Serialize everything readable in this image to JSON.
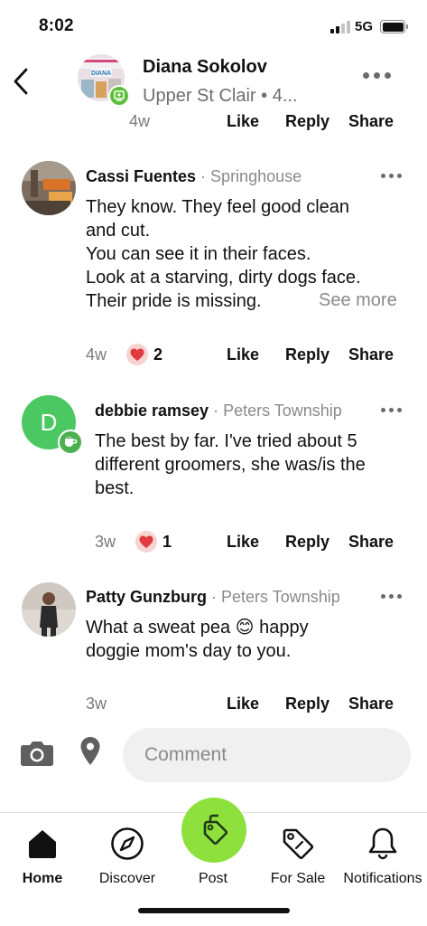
{
  "status_bar": {
    "time": "8:02",
    "network": "5G"
  },
  "header": {
    "author": "Diana Sokolov",
    "subtitle": "Upper St Clair • 4...",
    "avatar_text": "DIANA"
  },
  "main_post": {
    "ago": "4w",
    "like": "Like",
    "reply": "Reply",
    "share": "Share"
  },
  "comments": [
    {
      "author": "Cassi Fuentes",
      "separator": " · ",
      "location": "Springhouse",
      "lines": [
        "They know. They feel good clean",
        "and cut.",
        "You can see it in their faces.",
        "Look at a starving, dirty dogs face.",
        "Their pride is missing."
      ],
      "see_more": "See more",
      "ago": "4w",
      "reactions": "2",
      "like": "Like",
      "reply": "Reply",
      "share": "Share"
    },
    {
      "author": "debbie ramsey",
      "separator": " · ",
      "location": "Peters Township",
      "avatar_letter": "D",
      "lines": [
        "The best by far.  I've tried about 5",
        "different groomers, she was/is the",
        "best."
      ],
      "ago": "3w",
      "reactions": "1",
      "like": "Like",
      "reply": "Reply",
      "share": "Share"
    },
    {
      "author": "Patty Gunzburg",
      "separator": " · ",
      "location": "Peters Township",
      "line1_before": "What a sweat pea ",
      "line1_emoji": "😊",
      "line1_after": " happy",
      "line2": "doggie mom's day to you.",
      "ago": "3w",
      "like": "Like",
      "reply": "Reply",
      "share": "Share"
    }
  ],
  "composer": {
    "placeholder": "Comment"
  },
  "nav": {
    "items": [
      {
        "label": "Home",
        "active": true
      },
      {
        "label": "Discover",
        "active": false
      },
      {
        "label": "Post",
        "active": false
      },
      {
        "label": "For Sale",
        "active": false
      },
      {
        "label": "Notifications",
        "active": false
      }
    ]
  },
  "colors": {
    "accent_green": "#8ee03c",
    "badge_green": "#5cbf3a",
    "heart_red": "#e0393e",
    "muted_gray": "#8a8a8a"
  }
}
